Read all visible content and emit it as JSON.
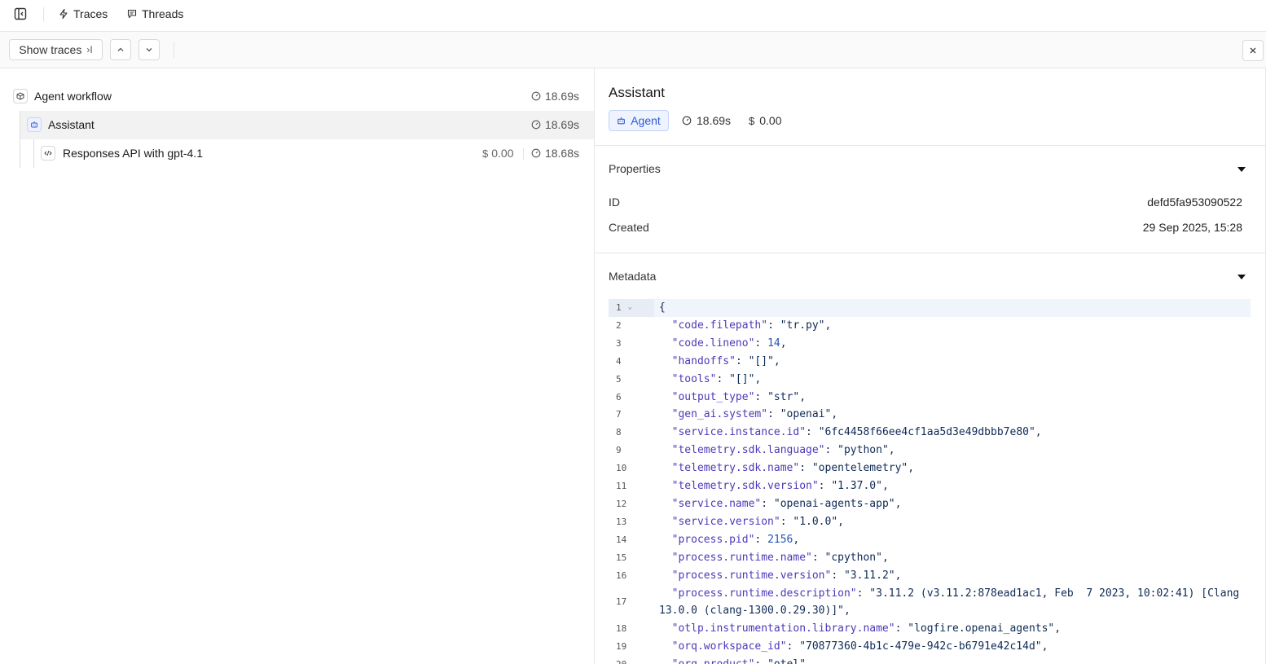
{
  "nav": {
    "tabs": [
      {
        "label": "Traces",
        "icon": "bolt-icon"
      },
      {
        "label": "Threads",
        "icon": "chat-bubble-icon"
      }
    ]
  },
  "toolbar": {
    "show_traces_label": "Show traces",
    "show_traces_glyph": "›I"
  },
  "tree": {
    "rows": [
      {
        "label": "Agent workflow",
        "duration": "18.69s",
        "icon": "cube-icon"
      },
      {
        "label": "Assistant",
        "duration": "18.69s",
        "icon": "robot-icon",
        "selected": true
      },
      {
        "label": "Responses API with gpt-4.1",
        "duration": "18.68s",
        "cost": "0.00",
        "icon": "code-icon"
      }
    ]
  },
  "detail": {
    "title": "Assistant",
    "badge": "Agent",
    "duration": "18.69s",
    "cost": "0.00",
    "properties": {
      "title": "Properties",
      "id_label": "ID",
      "id_value": "defd5fa953090522",
      "created_label": "Created",
      "created_value": "29 Sep 2025, 15:28"
    },
    "metadata": {
      "title": "Metadata",
      "lines": [
        {
          "n": "1",
          "html": "{"
        },
        {
          "n": "2",
          "key": "code.filepath",
          "val": "\"tr.py\""
        },
        {
          "n": "3",
          "key": "code.lineno",
          "num": "14"
        },
        {
          "n": "4",
          "key": "handoffs",
          "val": "\"[]\""
        },
        {
          "n": "5",
          "key": "tools",
          "val": "\"[]\""
        },
        {
          "n": "6",
          "key": "output_type",
          "val": "\"str\""
        },
        {
          "n": "7",
          "key": "gen_ai.system",
          "val": "\"openai\""
        },
        {
          "n": "8",
          "key": "service.instance.id",
          "val": "\"6fc4458f66ee4cf1aa5d3e49dbbb7e80\""
        },
        {
          "n": "9",
          "key": "telemetry.sdk.language",
          "val": "\"python\""
        },
        {
          "n": "10",
          "key": "telemetry.sdk.name",
          "val": "\"opentelemetry\""
        },
        {
          "n": "11",
          "key": "telemetry.sdk.version",
          "val": "\"1.37.0\""
        },
        {
          "n": "12",
          "key": "service.name",
          "val": "\"openai-agents-app\""
        },
        {
          "n": "13",
          "key": "service.version",
          "val": "\"1.0.0\""
        },
        {
          "n": "14",
          "key": "process.pid",
          "num": "2156"
        },
        {
          "n": "15",
          "key": "process.runtime.name",
          "val": "\"cpython\""
        },
        {
          "n": "16",
          "key": "process.runtime.version",
          "val": "\"3.11.2\""
        },
        {
          "n": "17",
          "key": "process.runtime.description",
          "val": "\"3.11.2 (v3.11.2:878ead1ac1, Feb  7 2023, 10:02:41) [Clang 13.0.0 (clang-1300.0.29.30)]\"",
          "tall": true
        },
        {
          "n": "18",
          "key": "otlp.instrumentation.library.name",
          "val": "\"logfire.openai_agents\""
        },
        {
          "n": "19",
          "key": "orq.workspace_id",
          "val": "\"70877360-4b1c-479e-942c-b6791e42c14d\""
        },
        {
          "n": "20",
          "key": "orq.product",
          "val": "\"otel\""
        }
      ]
    }
  },
  "colors": {
    "accent": "#2f5bd3",
    "json_key": "#4b3ab8",
    "json_number": "#2553b5"
  }
}
